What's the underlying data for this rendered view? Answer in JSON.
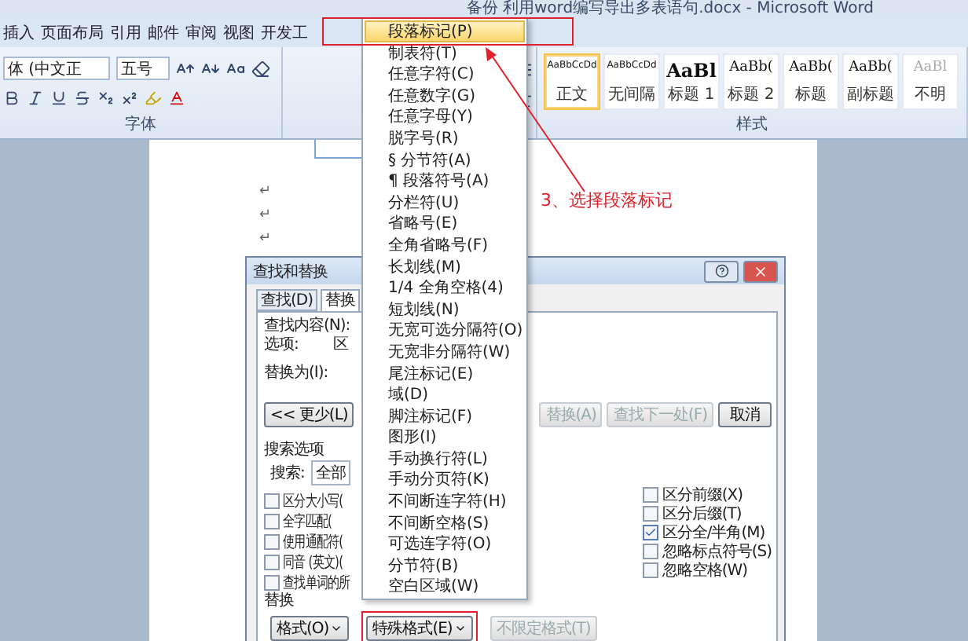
{
  "window": {
    "title": "备份 利用word编写导出多表语句.docx - Microsoft Word"
  },
  "ribbon_tabs": [
    {
      "label": "插入"
    },
    {
      "label": "页面布局"
    },
    {
      "label": "引用"
    },
    {
      "label": "邮件"
    },
    {
      "label": "审阅"
    },
    {
      "label": "视图"
    },
    {
      "label": "开发工"
    }
  ],
  "font_group": {
    "font_name": "体 (中文正",
    "font_size": "五号",
    "label": "字体"
  },
  "styles_group": {
    "label": "样式",
    "styles": [
      {
        "preview": "AaBbCcDd",
        "name": "正文",
        "kind": "body",
        "selected": true
      },
      {
        "preview": "AaBbCcDd",
        "name": "无间隔",
        "kind": "body",
        "selected": false
      },
      {
        "preview": "AaBl",
        "name": "标题 1",
        "kind": "heading1",
        "selected": false
      },
      {
        "preview": "AaBb(",
        "name": "标题 2",
        "kind": "heading",
        "selected": false
      },
      {
        "preview": "AaBb(",
        "name": "标题",
        "kind": "heading",
        "selected": false
      },
      {
        "preview": "AaBb(",
        "name": "副标题",
        "kind": "heading",
        "selected": false
      },
      {
        "preview": "AaBl",
        "name": "不明",
        "kind": "faint",
        "selected": false
      }
    ]
  },
  "document": {
    "paragraph_marks": [
      "↵",
      "↵",
      "↵"
    ]
  },
  "dialog": {
    "title": "查找和替换",
    "tabs": [
      {
        "label": "查找(D)",
        "selected": false
      },
      {
        "label": "替换",
        "selected": true
      }
    ],
    "find_label": "查找内容(N):",
    "options_label": "选项:",
    "options_value": "区",
    "replace_label": "替换为(I):",
    "less_button": "<< 更少(L)",
    "action_buttons": [
      {
        "label": "替换(A)",
        "disabled": true
      },
      {
        "label": "查找下一处(F)",
        "disabled": true
      },
      {
        "label": "取消",
        "disabled": false
      }
    ],
    "search_options_label": "搜索选项",
    "search_label": "搜索:",
    "search_value": "全部",
    "options_left": [
      {
        "label": "区分大小写(",
        "checked": false
      },
      {
        "label": "全字匹配(",
        "checked": false
      },
      {
        "label": "使用通配符(",
        "checked": false
      },
      {
        "label": "同音 (英文)(",
        "checked": false
      },
      {
        "label": "查找单词的所",
        "checked": false
      }
    ],
    "options_right": [
      {
        "label": "区分前缀(X)",
        "checked": false
      },
      {
        "label": "区分后缀(T)",
        "checked": false
      },
      {
        "label": "区分全/半角(M)",
        "checked": true
      },
      {
        "label": "忽略标点符号(S)",
        "checked": false
      },
      {
        "label": "忽略空格(W)",
        "checked": false
      }
    ],
    "replace_section_label": "替换",
    "bottom_buttons": [
      {
        "label": "格式(O)",
        "disabled": false,
        "dropdown": true
      },
      {
        "label": "特殊格式(E)",
        "disabled": false,
        "dropdown": true
      },
      {
        "label": "不限定格式(T)",
        "disabled": true,
        "dropdown": false
      }
    ]
  },
  "special_menu": {
    "items": [
      {
        "label": "段落标记(P)",
        "selected": true
      },
      {
        "label": "制表符(T)",
        "selected": false
      },
      {
        "label": "任意字符(C)",
        "selected": false
      },
      {
        "label": "任意数字(G)",
        "selected": false
      },
      {
        "label": "任意字母(Y)",
        "selected": false
      },
      {
        "label": "脱字号(R)",
        "selected": false
      },
      {
        "label": "§ 分节符(A)",
        "selected": false
      },
      {
        "label": "¶ 段落符号(A)",
        "selected": false
      },
      {
        "label": "分栏符(U)",
        "selected": false
      },
      {
        "label": "省略号(E)",
        "selected": false
      },
      {
        "label": "全角省略号(F)",
        "selected": false
      },
      {
        "label": "长划线(M)",
        "selected": false
      },
      {
        "label": "1/4 全角空格(4)",
        "selected": false
      },
      {
        "label": "短划线(N)",
        "selected": false
      },
      {
        "label": "无宽可选分隔符(O)",
        "selected": false
      },
      {
        "label": "无宽非分隔符(W)",
        "selected": false
      },
      {
        "label": "尾注标记(E)",
        "selected": false
      },
      {
        "label": "域(D)",
        "selected": false
      },
      {
        "label": "脚注标记(F)",
        "selected": false
      },
      {
        "label": "图形(I)",
        "selected": false
      },
      {
        "label": "手动换行符(L)",
        "selected": false
      },
      {
        "label": "手动分页符(K)",
        "selected": false
      },
      {
        "label": "不间断连字符(H)",
        "selected": false
      },
      {
        "label": "不间断空格(S)",
        "selected": false
      },
      {
        "label": "可选连字符(O)",
        "selected": false
      },
      {
        "label": "分节符(B)",
        "selected": false
      },
      {
        "label": "空白区域(W)",
        "selected": false
      }
    ]
  },
  "annotation": {
    "text": "3、选择段落标记"
  }
}
